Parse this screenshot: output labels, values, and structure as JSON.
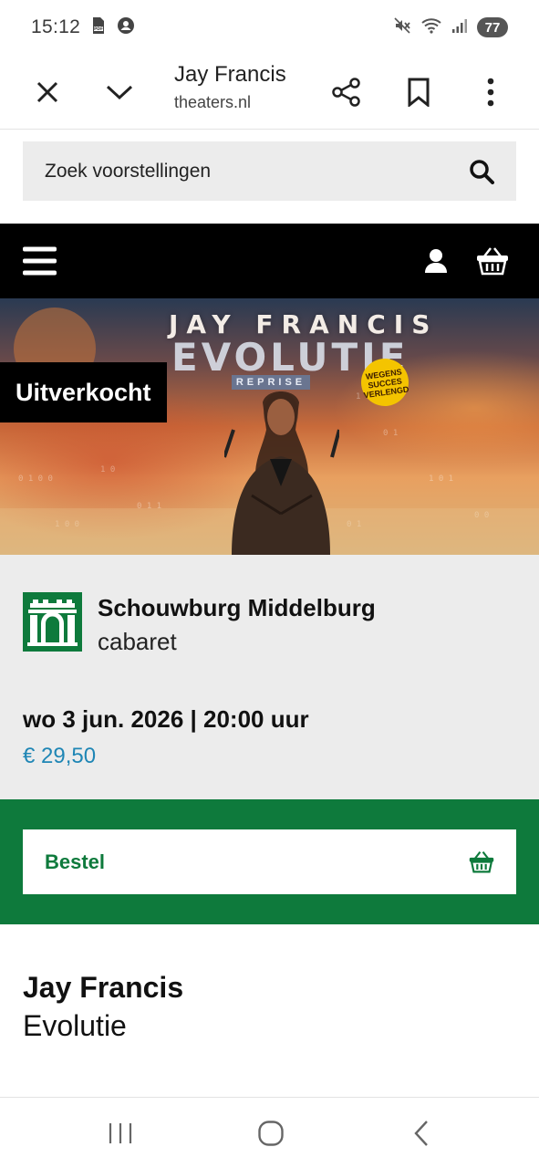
{
  "status_bar": {
    "time": "15:12",
    "battery": "77",
    "left_icons": [
      "pdf-icon",
      "account-icon"
    ],
    "right_icons": [
      "mute-icon",
      "wifi-icon",
      "signal-icon"
    ]
  },
  "browser": {
    "page_title": "Jay Francis",
    "domain": "theaters.nl",
    "buttons": [
      "close",
      "collapse",
      "share",
      "bookmark",
      "more"
    ]
  },
  "search": {
    "placeholder": "Zoek voorstellingen"
  },
  "site_nav": {
    "icons": [
      "menu-icon",
      "user-icon",
      "basket-icon"
    ]
  },
  "hero": {
    "title_line1": "JAY FRANCIS",
    "title_line2": "EVOLUTIE",
    "tag": "REPRISE",
    "badge": [
      "WEGENS",
      "SUCCES",
      "VERLENGD"
    ],
    "status_label": "Uitverkocht"
  },
  "event": {
    "venue": "Schouwburg Middelburg",
    "genre": "cabaret",
    "datetime": "wo 3 jun. 2026 | 20:00 uur",
    "price": "€ 29,50"
  },
  "order": {
    "button_label": "Bestel"
  },
  "show": {
    "artist": "Jay Francis",
    "title": "Evolutie"
  },
  "colors": {
    "brand_green": "#0e7a3c",
    "price_blue": "#1f86b5",
    "nav_black": "#000000",
    "panel_gray": "#ececec"
  }
}
